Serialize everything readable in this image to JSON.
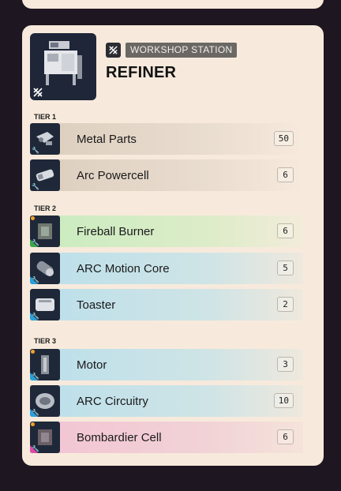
{
  "station": {
    "tag": "WORKSHOP STATION",
    "name": "REFINER"
  },
  "tiers": [
    {
      "label": "TIER 1",
      "items": [
        {
          "name": "Metal Parts",
          "count": "50",
          "rarity": "grey"
        },
        {
          "name": "Arc Powercell",
          "count": "6",
          "rarity": "grey"
        }
      ]
    },
    {
      "label": "TIER 2",
      "items": [
        {
          "name": "Fireball Burner",
          "count": "6",
          "rarity": "green"
        },
        {
          "name": "ARC Motion Core",
          "count": "5",
          "rarity": "blue"
        },
        {
          "name": "Toaster",
          "count": "2",
          "rarity": "blue"
        }
      ]
    },
    {
      "label": "TIER 3",
      "items": [
        {
          "name": "Motor",
          "count": "3",
          "rarity": "blue"
        },
        {
          "name": "ARC Circuitry",
          "count": "10",
          "rarity": "blue"
        },
        {
          "name": "Bombardier Cell",
          "count": "6",
          "rarity": "pink"
        }
      ]
    }
  ],
  "colors": {
    "card": "#f7eadc",
    "background": "#1e1620",
    "rarity_green": "#3aa84a",
    "rarity_blue": "#2aa0d8",
    "rarity_pink": "#e04aa8",
    "new_dot": "#f2a22a"
  }
}
